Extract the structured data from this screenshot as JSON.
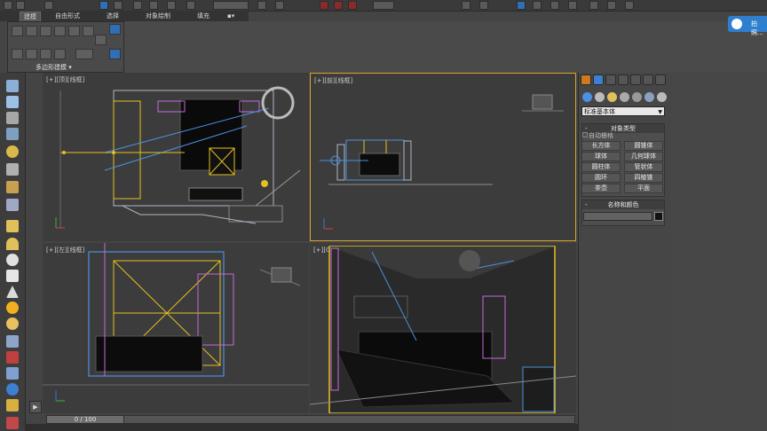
{
  "ribbon": {
    "tabs": [
      "建模",
      "自由形式",
      "选择",
      "对象绘制",
      "填充"
    ],
    "panel_label": "多边形建模 ▾"
  },
  "badge": {
    "text": "拍照..."
  },
  "viewports": {
    "top": {
      "label": "[+][顶][线框]"
    },
    "front": {
      "label": "[+][前][线框]"
    },
    "left": {
      "label": "[+][左][线框]"
    },
    "camera": {
      "label": "[+][Camera001][线框]"
    }
  },
  "timeline": {
    "value": "0 / 100"
  },
  "command_panel": {
    "dropdown": "标准基本体",
    "object_type": {
      "title": "对象类型",
      "autogrid": "自动栅格",
      "buttons": [
        "长方体",
        "圆锥体",
        "球体",
        "几何球体",
        "圆柱体",
        "管状体",
        "圆环",
        "四棱锥",
        "茶壶",
        "平面"
      ]
    },
    "name_color": {
      "title": "名称和颜色"
    }
  },
  "colors": {
    "active_border": "#d9a62a",
    "wire_blue": "#4d8fe0",
    "wire_yellow": "#e6c01e",
    "wire_magenta": "#c56ad8",
    "bg_viewport": "#3c3c3c"
  }
}
